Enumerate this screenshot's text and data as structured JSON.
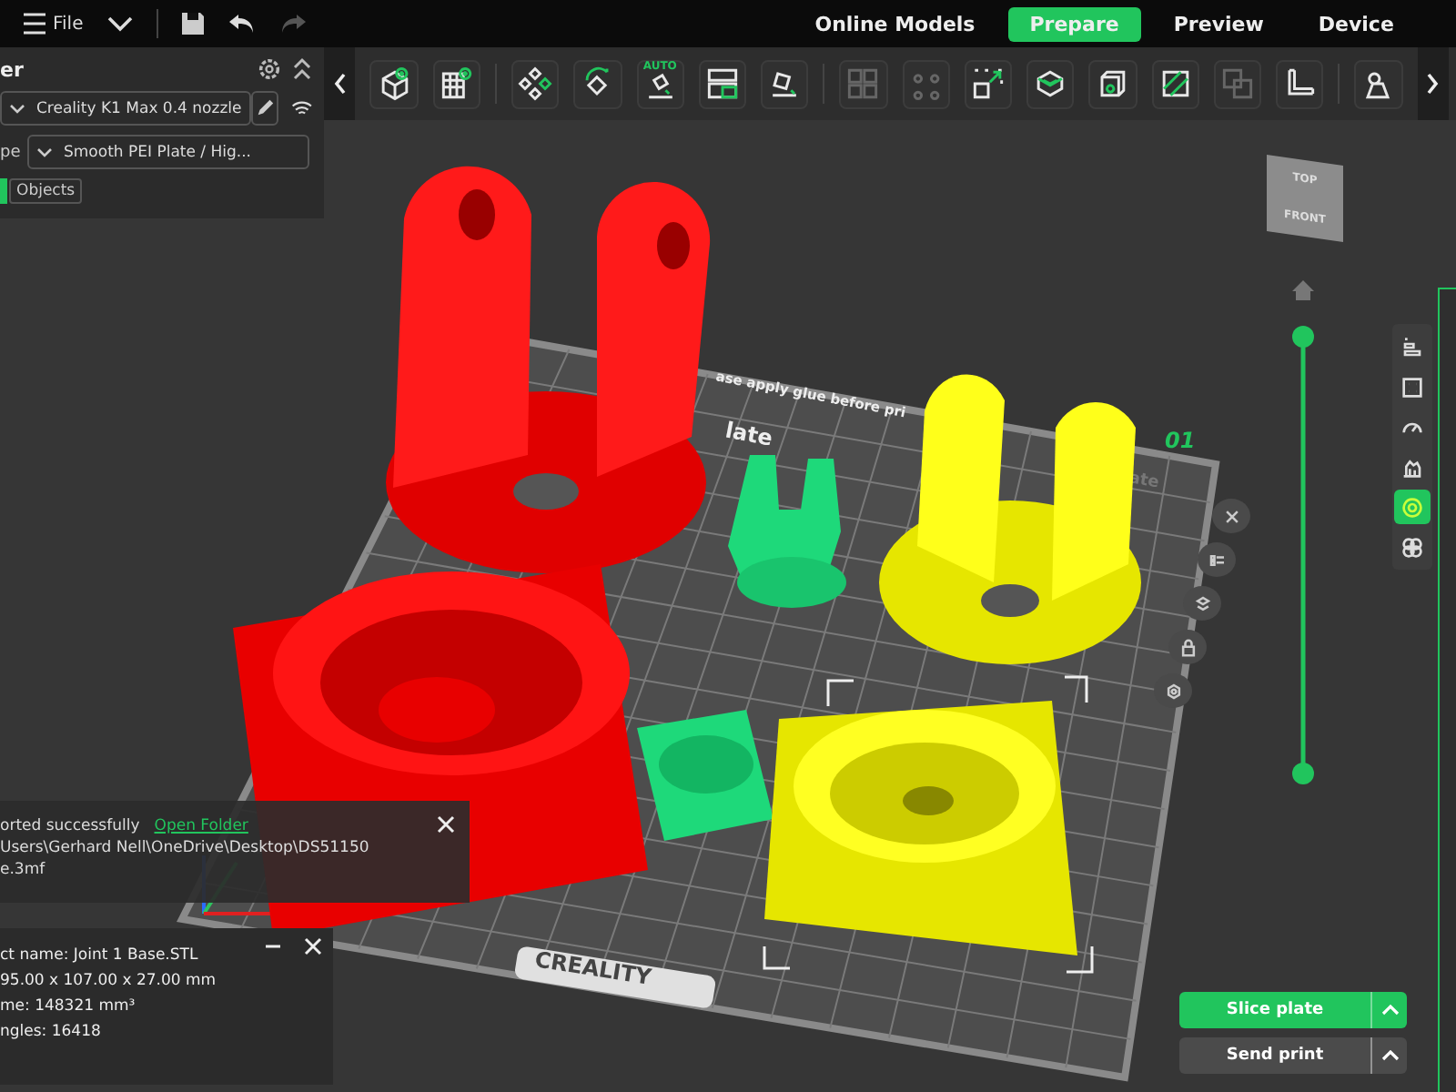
{
  "menu_bar": {
    "file_label": "File"
  },
  "mode_tabs": [
    {
      "label": "Online Models",
      "selected": false
    },
    {
      "label": "Prepare",
      "selected": true
    },
    {
      "label": "Preview",
      "selected": false
    },
    {
      "label": "Device",
      "selected": false
    }
  ],
  "printer_panel": {
    "title": "er",
    "printer": "Creality K1 Max 0.4 nozzle",
    "plate_type_label": "pe",
    "plate_type": "Smooth PEI Plate / Hig...",
    "tabs": [
      {
        "selected": true
      },
      {
        "label": "Objects",
        "selected": false
      }
    ]
  },
  "toolbar_groups": [
    [
      {
        "kind": "add-cube",
        "disabled": false
      },
      {
        "kind": "add-plate",
        "disabled": false
      }
    ],
    [
      {
        "kind": "arrange",
        "disabled": false
      },
      {
        "kind": "orient",
        "disabled": false
      },
      {
        "kind": "auto-orient",
        "label": "AUTO",
        "disabled": false
      },
      {
        "kind": "layout",
        "disabled": false
      },
      {
        "kind": "lay-flat",
        "disabled": false
      }
    ],
    [
      {
        "kind": "split-objects",
        "disabled": true
      },
      {
        "kind": "split-parts",
        "disabled": true
      },
      {
        "kind": "scale",
        "disabled": false
      },
      {
        "kind": "support",
        "disabled": false
      },
      {
        "kind": "box",
        "disabled": false
      },
      {
        "kind": "cut",
        "disabled": false
      },
      {
        "kind": "boolean",
        "disabled": true
      },
      {
        "kind": "measure",
        "disabled": false
      }
    ],
    [
      {
        "kind": "assembly",
        "disabled": false
      }
    ]
  ],
  "layer_slider": {
    "thumbs": [
      {
        "level": 1
      },
      {
        "level": 0
      }
    ]
  },
  "viewport": {
    "nav_cube": {
      "top": "TOP",
      "front": "FRONT"
    },
    "plate": {
      "notice": "ase apply glue before pri",
      "name": "late",
      "number": "01",
      "side_name": "ate",
      "brand": "CREALITY"
    }
  },
  "plate_tools": [
    {
      "kind": "close"
    },
    {
      "kind": "list"
    },
    {
      "kind": "arrange"
    },
    {
      "kind": "lock"
    },
    {
      "kind": "settings"
    }
  ],
  "view_tools": [
    {
      "kind": "layers",
      "selected": false
    },
    {
      "kind": "frame",
      "selected": false
    },
    {
      "kind": "speed",
      "selected": false
    },
    {
      "kind": "shell",
      "selected": false
    },
    {
      "kind": "target",
      "selected": true
    },
    {
      "kind": "quad",
      "selected": false
    }
  ],
  "notification": {
    "message": "orted successfully",
    "link": "Open Folder",
    "path_lines": [
      "Users\\Gerhard Nell\\OneDrive\\Desktop\\DS51150",
      "e.3mf"
    ]
  },
  "object_info": {
    "lines": [
      "ct name: Joint 1 Base.STL",
      "95.00 x 107.00 x 27.00 mm",
      "me: 148321 mm³",
      "ngles: 16418"
    ]
  },
  "actions": [
    {
      "label": "Slice plate",
      "kind": "primary"
    },
    {
      "label": "Send print",
      "kind": "secondary"
    }
  ]
}
